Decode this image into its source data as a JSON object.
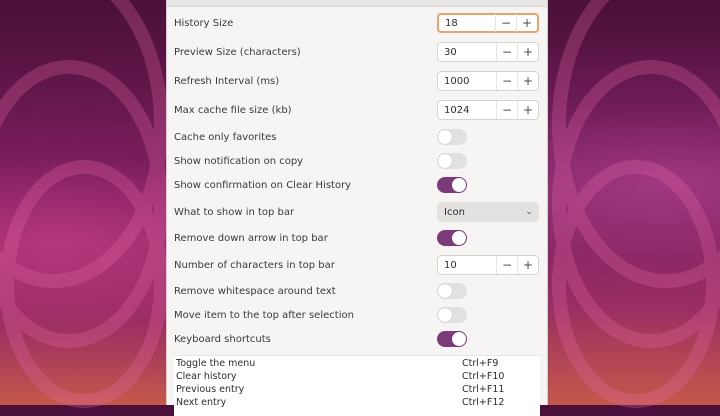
{
  "settings": {
    "history_size": {
      "label": "History Size",
      "value": "18"
    },
    "preview_size": {
      "label": "Preview Size (characters)",
      "value": "30"
    },
    "refresh_interval": {
      "label": "Refresh Interval (ms)",
      "value": "1000"
    },
    "max_cache": {
      "label": "Max cache file size (kb)",
      "value": "1024"
    },
    "cache_only_favorites": {
      "label": "Cache only favorites",
      "on": false
    },
    "show_notification": {
      "label": "Show notification on copy",
      "on": false
    },
    "show_confirmation": {
      "label": "Show confirmation on Clear History",
      "on": true
    },
    "top_bar_show": {
      "label": "What to show in top bar",
      "value": "Icon"
    },
    "remove_down_arrow": {
      "label": "Remove down arrow in top bar",
      "on": true
    },
    "topbar_chars": {
      "label": "Number of characters in top bar",
      "value": "10"
    },
    "remove_whitespace": {
      "label": "Remove whitespace around text",
      "on": false
    },
    "move_item_top": {
      "label": "Move item to the top after selection",
      "on": false
    },
    "keyboard_shortcuts": {
      "label": "Keyboard shortcuts",
      "on": true
    }
  },
  "spin_buttons": {
    "minus": "−",
    "plus": "+"
  },
  "shortcuts": [
    {
      "action": "Toggle the menu",
      "keys": "Ctrl+F9"
    },
    {
      "action": "Clear history",
      "keys": "Ctrl+F10"
    },
    {
      "action": "Previous entry",
      "keys": "Ctrl+F11"
    },
    {
      "action": "Next entry",
      "keys": "Ctrl+F12"
    }
  ],
  "colors": {
    "toggle_on": "#7d3a7a",
    "focus_border": "#e8a36f"
  }
}
